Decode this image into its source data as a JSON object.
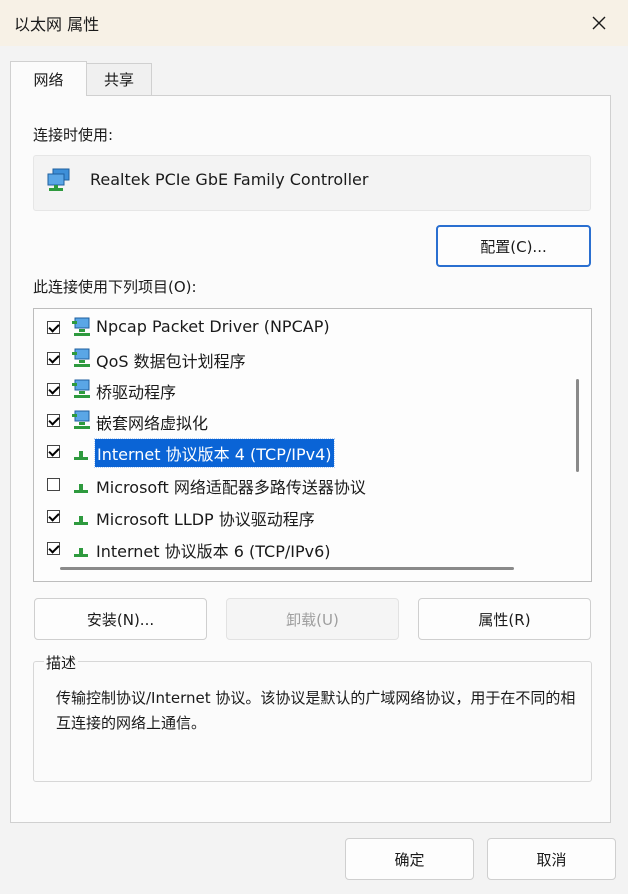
{
  "window": {
    "title": "以太网 属性"
  },
  "tabs": [
    {
      "label": "网络"
    },
    {
      "label": "共享"
    }
  ],
  "connect_using": {
    "label": "连接时使用:",
    "adapter_name": "Realtek PCIe GbE Family Controller",
    "icon": "network-adapter-icon",
    "configure_button": "配置(C)..."
  },
  "items_section": {
    "label": "此连接使用下列项目(O):"
  },
  "items": [
    {
      "label": "Npcap Packet Driver (NPCAP)",
      "checked": true,
      "icon": "network-service-icon",
      "selected": false
    },
    {
      "label": "QoS 数据包计划程序",
      "checked": true,
      "icon": "network-service-icon",
      "selected": false
    },
    {
      "label": "桥驱动程序",
      "checked": true,
      "icon": "network-service-icon",
      "selected": false
    },
    {
      "label": "嵌套网络虚拟化",
      "checked": true,
      "icon": "network-service-icon",
      "selected": false
    },
    {
      "label": "Internet 协议版本 4 (TCP/IPv4)",
      "checked": true,
      "icon": "protocol-icon",
      "selected": true
    },
    {
      "label": "Microsoft 网络适配器多路传送器协议",
      "checked": false,
      "icon": "protocol-icon",
      "selected": false
    },
    {
      "label": "Microsoft LLDP 协议驱动程序",
      "checked": true,
      "icon": "protocol-icon",
      "selected": false
    },
    {
      "label": "Internet 协议版本 6 (TCP/IPv6)",
      "checked": true,
      "icon": "protocol-icon",
      "selected": false
    }
  ],
  "action_buttons": {
    "install": "安装(N)...",
    "uninstall": "卸载(U)",
    "properties": "属性(R)"
  },
  "description": {
    "legend": "描述",
    "text": "传输控制协议/Internet 协议。该协议是默认的广域网络协议，用于在不同的相互连接的网络上通信。"
  },
  "footer": {
    "ok": "确定",
    "cancel": "取消"
  },
  "colors": {
    "accent": "#0a64d6",
    "titlebar": "#f7f1e6",
    "icon_green": "#2e9a3e",
    "icon_blue": "#3d8fd8"
  }
}
